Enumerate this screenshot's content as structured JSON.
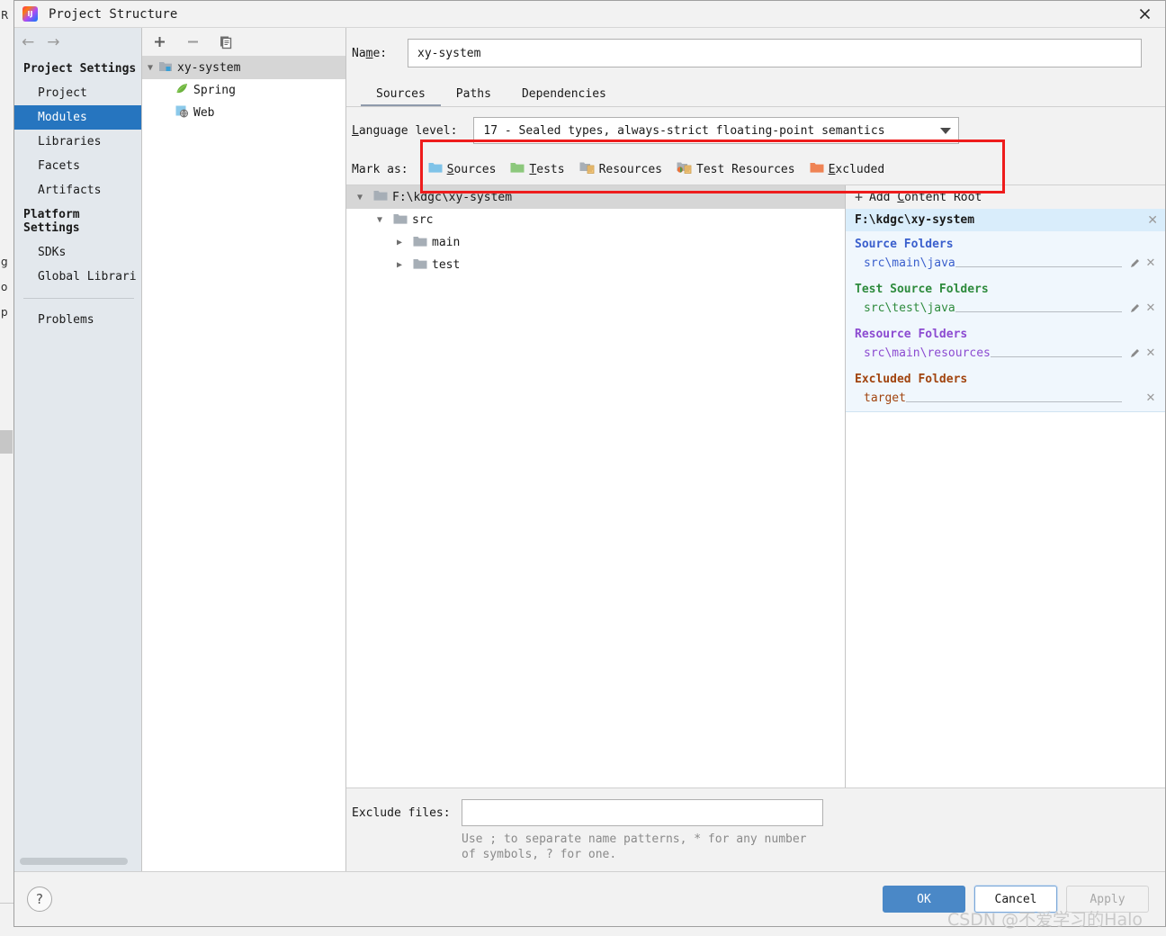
{
  "window": {
    "title": "Project Structure",
    "app_icon": "intellij-idea-icon",
    "close_icon": "close-icon"
  },
  "backdrop": {
    "left_letters": [
      "R",
      "g",
      "o",
      "p"
    ],
    "run_icon": "run-arrow-icon"
  },
  "sidebar": {
    "back_icon": "arrow-left-icon",
    "forward_icon": "arrow-right-icon",
    "groups": [
      {
        "title": "Project Settings",
        "items": [
          "Project",
          "Modules",
          "Libraries",
          "Facets",
          "Artifacts"
        ]
      },
      {
        "title": "Platform Settings",
        "items": [
          "SDKs",
          "Global Librari"
        ]
      }
    ],
    "extra_items": [
      "Problems"
    ],
    "selected": "Modules"
  },
  "module_panel": {
    "toolbar": {
      "add_icon": "plus-icon",
      "remove_icon": "minus-icon",
      "copy_icon": "copy-icon"
    },
    "tree": [
      {
        "label": "xy-system",
        "icon": "module-folder-icon",
        "expanded": true,
        "selected": true,
        "depth": 0
      },
      {
        "label": "Spring",
        "icon": "spring-leaf-icon",
        "depth": 1
      },
      {
        "label": "Web",
        "icon": "web-icon",
        "depth": 1
      }
    ]
  },
  "main": {
    "name_label": "Name:",
    "name_label_mnemonic": "m",
    "name_value": "xy-system",
    "tabs": [
      {
        "label": "Sources",
        "active": true
      },
      {
        "label": "Paths",
        "active": false
      },
      {
        "label": "Dependencies",
        "active": false
      }
    ],
    "language_level": {
      "label": "Language level:",
      "label_mnemonic": "L",
      "value": "17 - Sealed types, always-strict floating-point semantics",
      "caret_icon": "chevron-down-icon"
    },
    "mark_as": {
      "label": "Mark as:",
      "options": [
        {
          "label": "Sources",
          "mnemonic": "S",
          "icon": "folder-sources-icon",
          "color": "#7fc3e8"
        },
        {
          "label": "Tests",
          "mnemonic": "T",
          "icon": "folder-tests-icon",
          "color": "#8cc87c"
        },
        {
          "label": "Resources",
          "mnemonic": "",
          "icon": "folder-resources-icon",
          "color": "#a8afb6"
        },
        {
          "label": "Test Resources",
          "mnemonic": "",
          "icon": "folder-test-resources-icon",
          "color": "#a8afb6"
        },
        {
          "label": "Excluded",
          "mnemonic": "E",
          "icon": "folder-excluded-icon",
          "color": "#ef8354"
        }
      ]
    },
    "source_tree": [
      {
        "label": "F:\\kdgc\\xy-system",
        "depth": 0,
        "expanded": true,
        "selected": true
      },
      {
        "label": "src",
        "depth": 1,
        "expanded": true,
        "selected": false
      },
      {
        "label": "main",
        "depth": 2,
        "expanded": false,
        "selected": false
      },
      {
        "label": "test",
        "depth": 2,
        "expanded": false,
        "selected": false
      }
    ],
    "exclude_files": {
      "label": "Exclude files:",
      "value": "",
      "hint": "Use ; to separate name patterns, * for any number of symbols, ? for one."
    }
  },
  "roots_panel": {
    "add_content_root": "Add Content Root",
    "add_content_root_mnemonic": "C",
    "add_icon": "plus-icon",
    "root_path": "F:\\kdgc\\xy-system",
    "remove_icon": "close-icon",
    "edit_icon": "pencil-icon",
    "sections": [
      {
        "title": "Source Folders",
        "color": "#3a5fcd",
        "entries": [
          {
            "path": "src\\main\\java",
            "editable": true,
            "removable": true
          }
        ]
      },
      {
        "title": "Test Source Folders",
        "color": "#2e8b3d",
        "entries": [
          {
            "path": "src\\test\\java",
            "editable": true,
            "removable": true
          }
        ]
      },
      {
        "title": "Resource Folders",
        "color": "#8c4bd1",
        "entries": [
          {
            "path": "src\\main\\resources",
            "editable": true,
            "removable": true
          }
        ]
      },
      {
        "title": "Excluded Folders",
        "color": "#a1440f",
        "entries": [
          {
            "path": "target",
            "editable": false,
            "removable": true
          }
        ]
      }
    ]
  },
  "footer": {
    "help_label": "?",
    "help_icon": "question-mark-icon",
    "buttons": [
      {
        "label": "OK",
        "style": "primary"
      },
      {
        "label": "Cancel",
        "style": "default"
      },
      {
        "label": "Apply",
        "style": "disabled"
      }
    ]
  },
  "watermark": "CSDN @不爱学习的Halo",
  "colors": {
    "accent": "#2675bf",
    "primary_button": "#4a88c7",
    "annotation": "#ee1c1c",
    "selection_row": "#d6d6d6",
    "root_card_bg": "#f0f7fd"
  }
}
